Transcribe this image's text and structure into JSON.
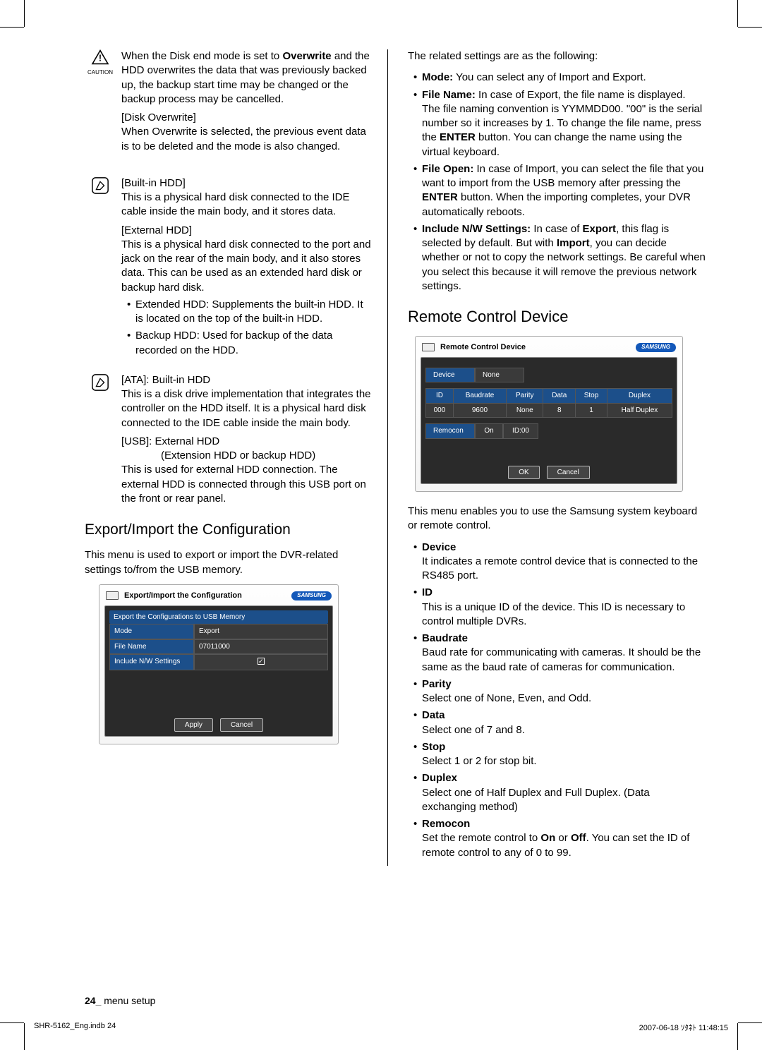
{
  "left": {
    "caution_label": "CAUTION",
    "caution_text_pre": "When the Disk end mode is set to ",
    "caution_bold": "Overwrite",
    "caution_text_post": " and the HDD overwrites the data that was previously backed up, the backup start time may be changed or the backup process may be cancelled.",
    "disk_ow_label": "[Disk Overwrite]",
    "disk_ow_text": "When Overwrite is selected, the previous event data is to be deleted and the mode is also changed.",
    "builtin_label": "[Built-in HDD]",
    "builtin_text": "This is a physical hard disk connected to the IDE cable inside the main body, and it stores data.",
    "external_label": "[External HDD]",
    "external_text": "This is a physical hard disk connected to the port and jack on the rear of the main body, and it also stores data. This can be used as an extended hard disk or backup hard disk.",
    "ext_b1": "Extended HDD: Supplements the built-in HDD. It is located on the top of the built-in HDD.",
    "ext_b2": "Backup HDD: Used for backup of the data recorded on the HDD.",
    "ata_label": "[ATA]: Built-in HDD",
    "ata_text": "This is a disk drive implementation that integrates the controller on the HDD itself. It is a physical hard disk connected to the IDE cable inside the main body.",
    "usb_label": "[USB]: External HDD",
    "usb_sub": "(Extension HDD or backup HDD)",
    "usb_text": "This is used for external HDD connection. The external HDD is connected through this USB port on the front or rear panel.",
    "exp_heading": "Export/Import the Configuration",
    "exp_intro": "This menu is used to export or import the DVR-related settings to/from the USB memory.",
    "ui1": {
      "title": "Export/Import the Configuration",
      "brand": "SAMSUNG",
      "subhead": "Export the Configurations to USB Memory",
      "row_mode_l": "Mode",
      "row_mode_v": "Export",
      "row_file_l": "File Name",
      "row_file_v": "07011000",
      "row_inc_l": "Include N/W Settings",
      "btn_apply": "Apply",
      "btn_cancel": "Cancel"
    }
  },
  "right": {
    "intro": "The related settings are as the following:",
    "b_mode_l": "Mode:",
    "b_mode_t": " You can select any of Import and Export.",
    "b_file_l": "File Name:",
    "b_file_t": " In case of Export, the file name is displayed. The file naming convention is YYMMDD00. \"00\" is the serial number so it increases by 1. To change the file name, press the ",
    "b_file_enter": "ENTER",
    "b_file_t2": " button. You can change the name using the virtual keyboard.",
    "b_open_l": "File Open:",
    "b_open_t": "  In case of Import, you can select the file that you want to import from the USB memory after pressing the ",
    "b_open_enter": "ENTER",
    "b_open_t2": " button. When the importing completes, your DVR automatically reboots.",
    "b_inc_l": "Include N/W Settings:",
    "b_inc_t1": " In case of ",
    "b_inc_exp": "Export",
    "b_inc_t2": ", this flag is selected by default. But with ",
    "b_inc_imp": "Import",
    "b_inc_t3": ", you can decide whether or not to copy the network settings. Be careful when you select this because it will remove the previous network settings.",
    "rc_heading": "Remote Control Device",
    "ui2": {
      "title": "Remote Control Device",
      "brand": "SAMSUNG",
      "dev_l": "Device",
      "dev_v": "None",
      "hdr": [
        "ID",
        "Baudrate",
        "Parity",
        "Data",
        "Stop",
        "Duplex"
      ],
      "row": [
        "000",
        "9600",
        "None",
        "8",
        "1",
        "Half Duplex"
      ],
      "rem_l": "Remocon",
      "rem_v1": "On",
      "rem_v2": "ID:00",
      "btn_ok": "OK",
      "btn_cancel": "Cancel"
    },
    "rc_intro": "This menu enables you to use the Samsung system keyboard or remote control.",
    "rc_items": {
      "device_l": "Device",
      "device_t": "It indicates a remote control device that is connected to the RS485 port.",
      "id_l": "ID",
      "id_t": "This is a unique ID of the device. This ID is necessary to control multiple DVRs.",
      "baud_l": "Baudrate",
      "baud_t": "Baud rate for communicating with cameras. It should be the same as the baud rate of cameras for communication.",
      "parity_l": "Parity",
      "parity_t": "Select one of None, Even, and Odd.",
      "data_l": "Data",
      "data_t": "Select one of 7 and 8.",
      "stop_l": "Stop",
      "stop_t": "Select 1 or 2 for stop bit.",
      "duplex_l": "Duplex",
      "duplex_t": "Select one of Half Duplex and Full Duplex. (Data exchanging method)",
      "rem_l": "Remocon",
      "rem_t1": "Set the remote control to ",
      "rem_on": "On",
      "rem_t2": " or ",
      "rem_off": "Off",
      "rem_t3": ". You can set the ID of remote control to any of 0 to 99."
    }
  },
  "footer": {
    "page": "24_",
    "section": " menu setup"
  },
  "printline": {
    "left": "SHR-5162_Eng.indb   24",
    "right": "2007-06-18   ｿﾀﾈﾄ 11:48:15"
  }
}
